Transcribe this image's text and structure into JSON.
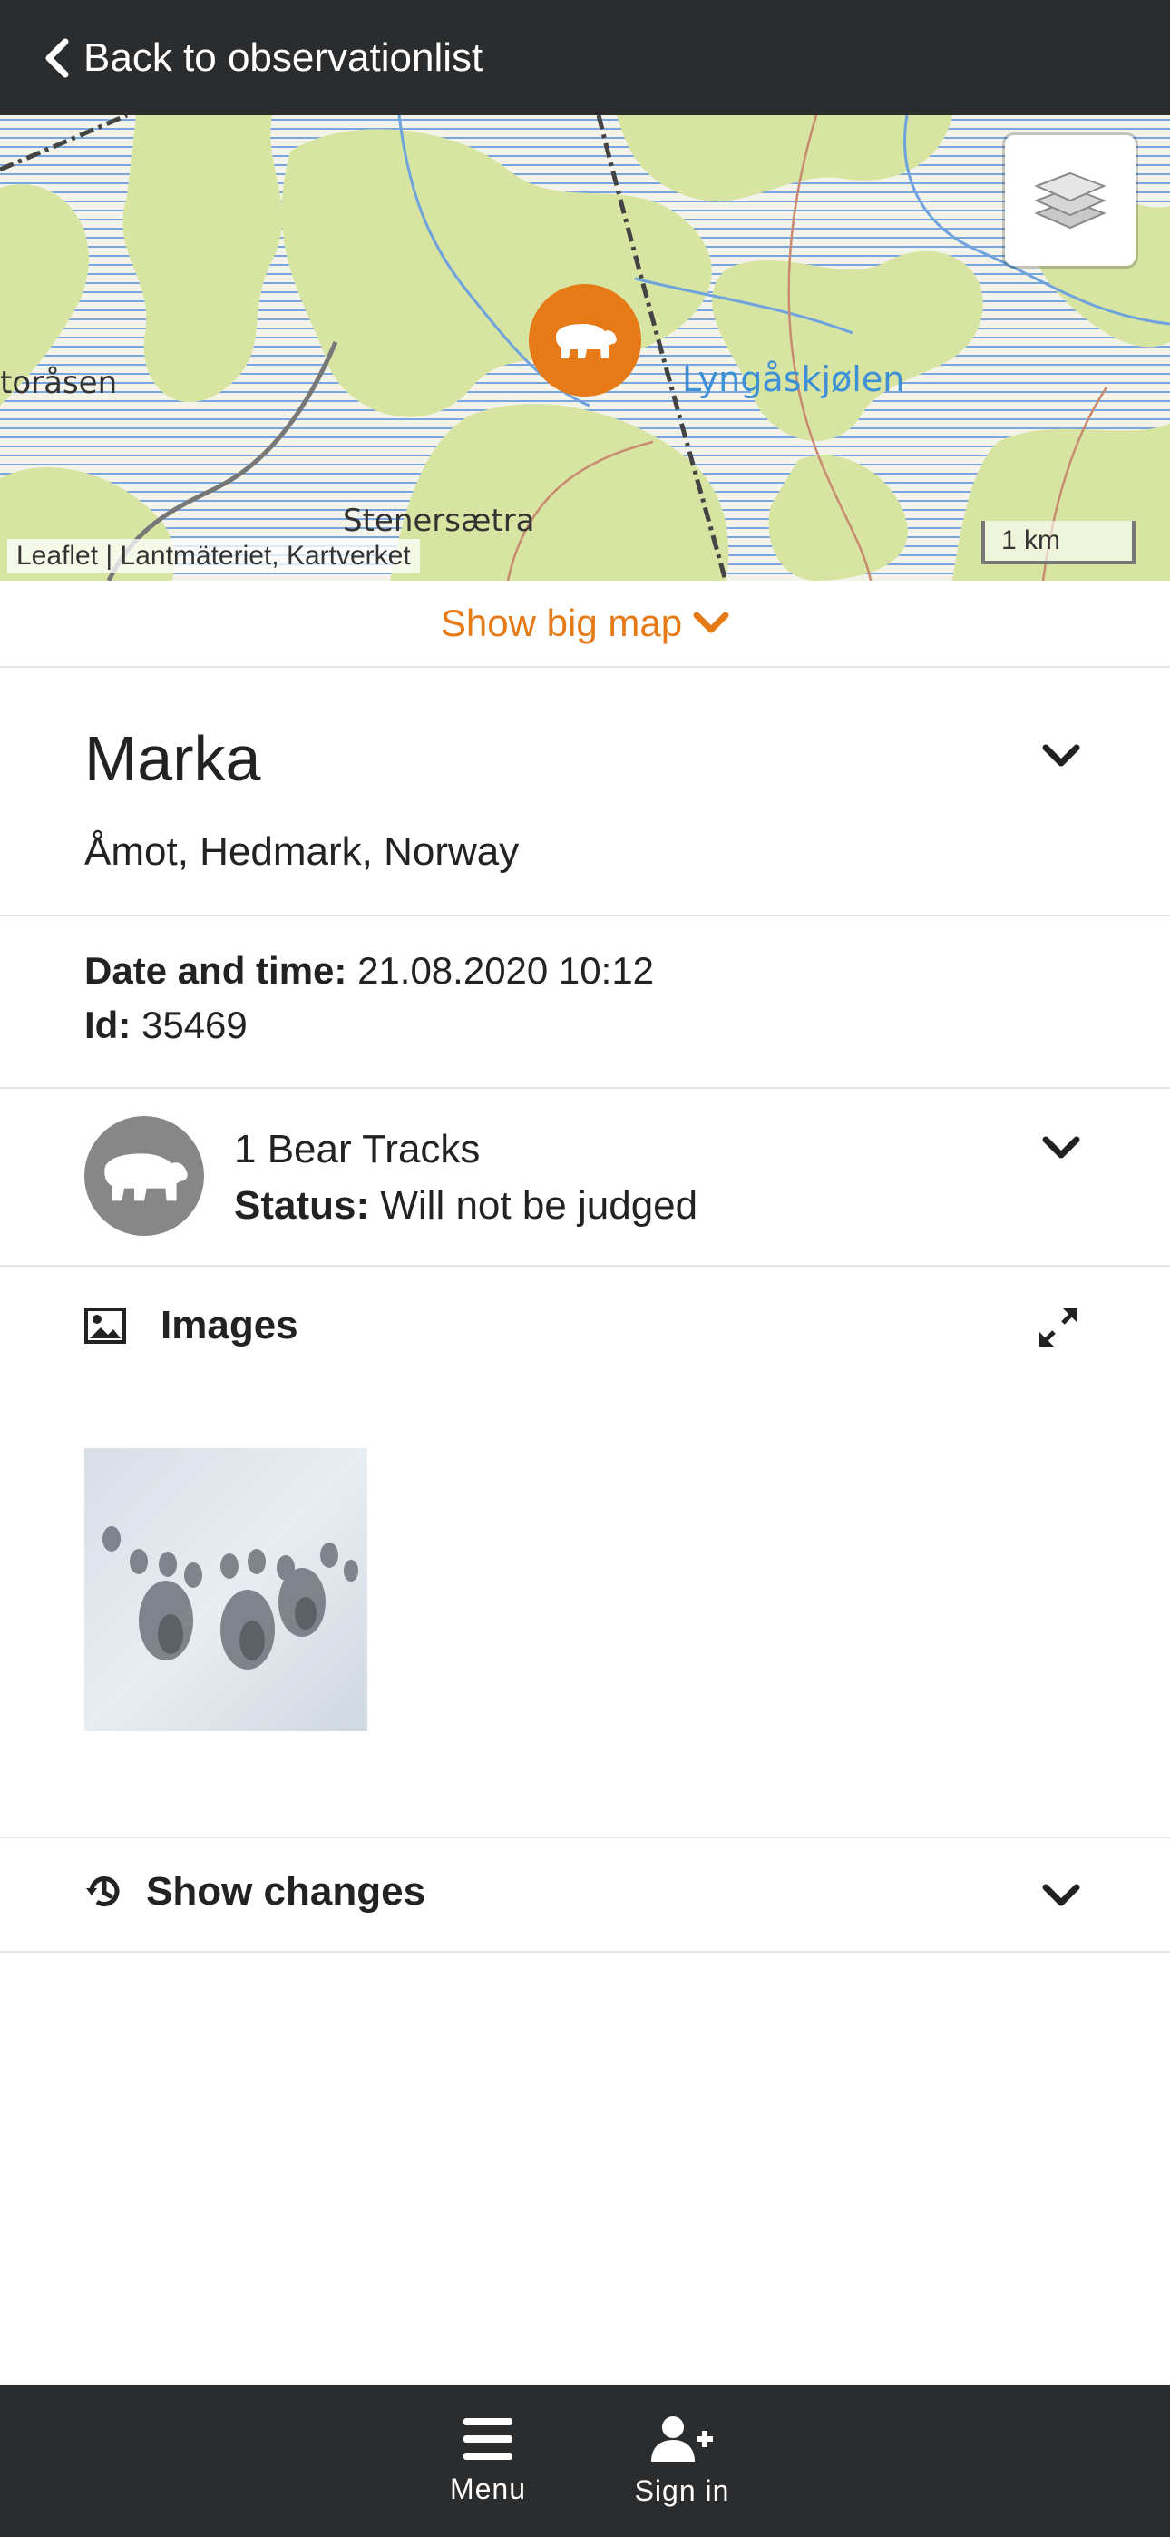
{
  "topbar": {
    "back_label": "Back to observationlist"
  },
  "map": {
    "attribution": "Leaflet | Lantmäteriet, Kartverket",
    "scale_label": "1 km",
    "place_labels": [
      "toråsen",
      "Lyngåskjølen",
      "Stenersætra"
    ],
    "marker_icon": "bear-icon",
    "layers_icon": "layers-icon"
  },
  "show_big_map": {
    "label": "Show big map"
  },
  "location": {
    "title": "Marka",
    "subtitle": "Åmot, Hedmark, Norway"
  },
  "details": {
    "date_label": "Date and time:",
    "date_value": "21.08.2020 10:12",
    "id_label": "Id:",
    "id_value": "35469"
  },
  "species": {
    "name": "1 Bear Tracks",
    "status_label": "Status:",
    "status_value": "Will not be judged"
  },
  "images": {
    "heading": "Images"
  },
  "changes": {
    "heading": "Show changes"
  },
  "bottom_nav": {
    "menu_label": "Menu",
    "signin_label": "Sign in"
  },
  "colors": {
    "accent": "#e57a16",
    "bar": "#2b2c2e",
    "species_circle": "#878787"
  }
}
